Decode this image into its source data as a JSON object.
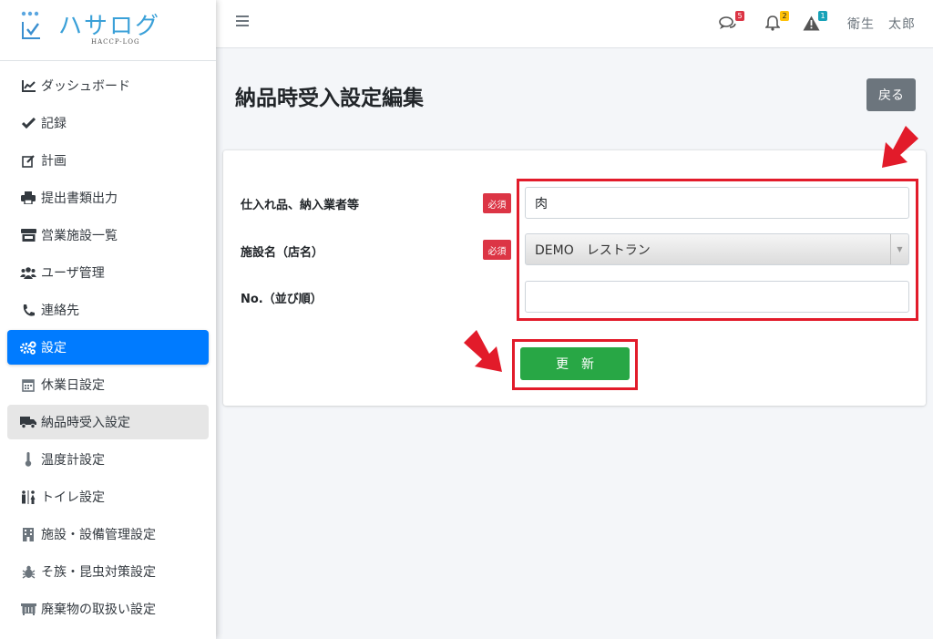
{
  "brand": {
    "name": "ハサログ",
    "sub": "HACCP-LOG"
  },
  "sidebar": {
    "items": [
      {
        "label": "ダッシュボード",
        "icon": "chart-line-icon"
      },
      {
        "label": "記録",
        "icon": "check-icon"
      },
      {
        "label": "計画",
        "icon": "edit-icon"
      },
      {
        "label": "提出書類出力",
        "icon": "print-icon"
      },
      {
        "label": "営業施設一覧",
        "icon": "store-icon"
      },
      {
        "label": "ユーザ管理",
        "icon": "users-icon"
      },
      {
        "label": "連絡先",
        "icon": "phone-icon"
      },
      {
        "label": "設定",
        "icon": "cogs-icon"
      },
      {
        "label": "休業日設定",
        "icon": "calendar-icon"
      },
      {
        "label": "納品時受入設定",
        "icon": "truck-icon"
      },
      {
        "label": "温度計設定",
        "icon": "thermometer-icon"
      },
      {
        "label": "トイレ設定",
        "icon": "restroom-icon"
      },
      {
        "label": "施設・設備管理設定",
        "icon": "building-icon"
      },
      {
        "label": "そ族・昆虫対策設定",
        "icon": "bug-icon"
      },
      {
        "label": "廃棄物の取扱い設定",
        "icon": "dumpster-icon"
      }
    ]
  },
  "topbar": {
    "messages_count": "5",
    "notifications_count": "2",
    "alerts_count": "1",
    "user_name": "衛生　太郎"
  },
  "page": {
    "title": "納品時受入設定編集",
    "back_label": "戻る"
  },
  "form": {
    "required_label": "必須",
    "supplier_label": "仕入れ品、納入業者等",
    "supplier_value": "肉",
    "facility_label": "施設名（店名）",
    "facility_value": "DEMO　レストラン",
    "order_label": "No.（並び順）",
    "order_value": "",
    "submit_label": "更新"
  },
  "colors": {
    "accent": "#007bff",
    "submit": "#28a745",
    "required": "#dc3545",
    "highlight": "#e21b2a",
    "back": "#6c757d"
  }
}
